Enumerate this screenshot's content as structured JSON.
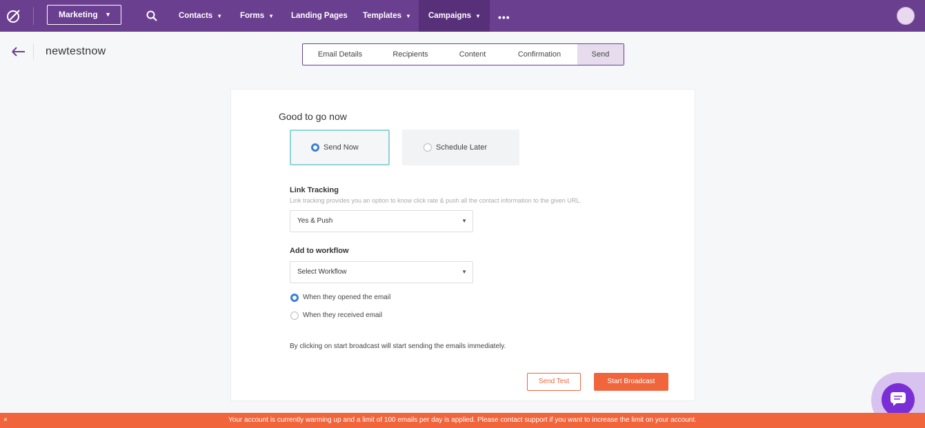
{
  "nav": {
    "workspace": "Marketing",
    "items": [
      {
        "label": "Contacts",
        "has_dropdown": true
      },
      {
        "label": "Forms",
        "has_dropdown": true
      },
      {
        "label": "Landing Pages",
        "has_dropdown": false
      },
      {
        "label": "Templates",
        "has_dropdown": true
      },
      {
        "label": "Campaigns",
        "has_dropdown": true,
        "active": true
      }
    ],
    "more": "•••",
    "colors": {
      "bar": "#6a3f8f",
      "active": "#58307a"
    }
  },
  "header": {
    "title": "newtestnow"
  },
  "steps": [
    {
      "label": "Email Details"
    },
    {
      "label": "Recipients"
    },
    {
      "label": "Content"
    },
    {
      "label": "Confirmation"
    },
    {
      "label": "Send",
      "active": true
    }
  ],
  "send": {
    "heading": "Good to go now",
    "options": [
      {
        "label": "Send Now",
        "selected": true
      },
      {
        "label": "Schedule Later",
        "selected": false
      }
    ],
    "link_tracking": {
      "label": "Link Tracking",
      "hint": "Link tracking provides you an option to know click rate & push all the contact information to the given URL.",
      "value": "Yes & Push"
    },
    "workflow": {
      "label": "Add to workflow",
      "value": "Select Workflow",
      "triggers": [
        {
          "label": "When they opened the email",
          "selected": true
        },
        {
          "label": "When they received email",
          "selected": false
        }
      ]
    },
    "note": "By clicking on start broadcast will start sending the emails immediately.",
    "buttons": {
      "test": "Send Test",
      "start": "Start Broadcast"
    },
    "accent": "#f0653c"
  },
  "banner": {
    "close": "×",
    "text": "Your account is currently warming up and a limit of 100 emails per day is applied. Please contact support if you want to increase the limit on your account.",
    "color": "#f0653c"
  }
}
